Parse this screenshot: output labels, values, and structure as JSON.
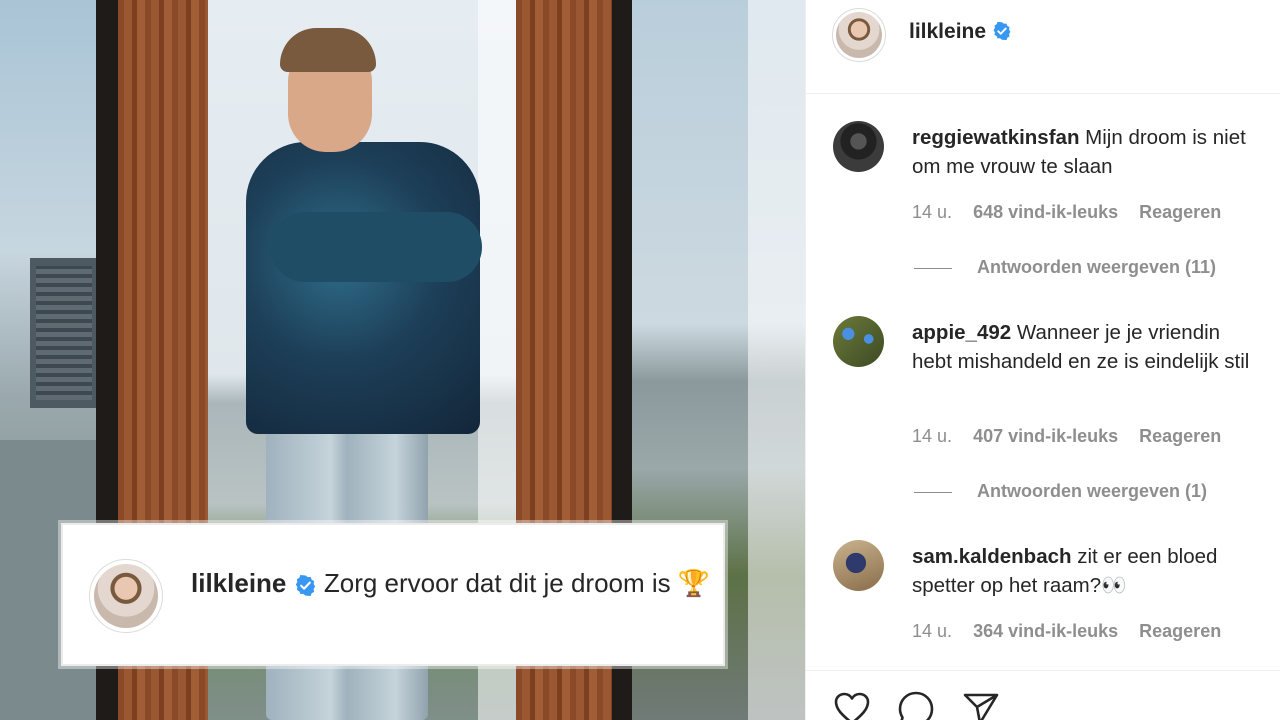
{
  "post": {
    "author": "lilkleine",
    "verified": true,
    "caption": "Zorg ervoor dat dit je droom is",
    "caption_emoji": "🏆"
  },
  "comments": [
    {
      "user": "reggiewatkinsfan",
      "text": "Mijn droom is niet om me vrouw te slaan",
      "time": "14 u.",
      "likes": "648 vind-ik-leuks",
      "reply_label": "Reageren",
      "view_replies": "Antwoorden weergeven (11)"
    },
    {
      "user": "appie_492",
      "text": "Wanneer je je vriendin hebt mishandeld en ze is eindelijk stil",
      "time": "14 u.",
      "likes": "407 vind-ik-leuks",
      "reply_label": "Reageren",
      "view_replies": "Antwoorden weergeven (1)"
    },
    {
      "user": "sam.kaldenbach",
      "text": "zit er een bloed spetter op het raam?👀",
      "time": "14 u.",
      "likes": "364 vind-ik-leuks",
      "reply_label": "Reageren"
    }
  ],
  "actions": {
    "icons": [
      "heart-icon",
      "comment-icon",
      "share-icon"
    ]
  },
  "colors": {
    "verified": "#3897f0",
    "text": "#262626",
    "muted": "#8e8e8e"
  }
}
